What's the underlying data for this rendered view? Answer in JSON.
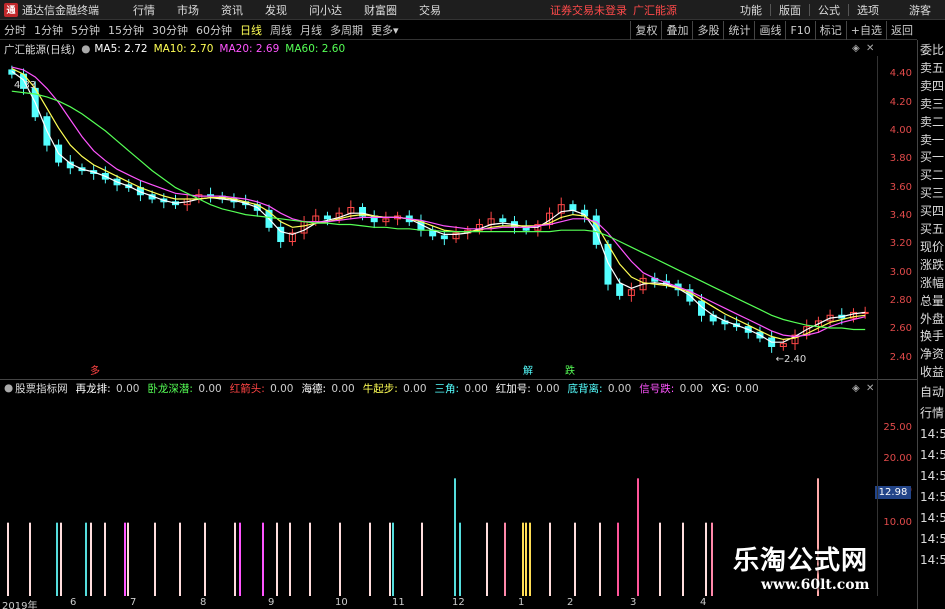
{
  "app": {
    "title": "通达信金融终端",
    "status": "证券交易未登录",
    "stock_short": "广汇能源",
    "menu": [
      "行情",
      "市场",
      "资讯",
      "发现",
      "问小达",
      "财富圈",
      "交易"
    ],
    "right_menu": [
      "功能",
      "版面",
      "公式",
      "选项"
    ],
    "guest": "游客"
  },
  "toolbar": {
    "items": [
      "分时",
      "1分钟",
      "5分钟",
      "15分钟",
      "30分钟",
      "60分钟",
      "日线",
      "周线",
      "月线",
      "多周期",
      "更多"
    ],
    "active": "日线",
    "right": [
      "复权",
      "叠加",
      "多股",
      "统计",
      "画线",
      "F10",
      "标记",
      "+自选",
      "返回"
    ]
  },
  "legend": {
    "stock": "广汇能源(日线)",
    "ma": [
      {
        "label": "MA5: 2.72",
        "color": "#ffffff"
      },
      {
        "label": "MA10: 2.70",
        "color": "#ffff55"
      },
      {
        "label": "MA20: 2.69",
        "color": "#ff55ff"
      },
      {
        "label": "MA60: 2.60",
        "color": "#55ff55"
      }
    ]
  },
  "price_axis": [
    "4.40",
    "4.20",
    "4.00",
    "3.80",
    "3.60",
    "3.40",
    "3.20",
    "3.00",
    "2.80",
    "2.60",
    "2.40"
  ],
  "annotations": {
    "high": "4.33",
    "low": "2.40",
    "signal_red": "多",
    "signal_a": "解",
    "signal_b": "跌"
  },
  "right_panel": [
    "委比",
    "卖五",
    "卖四",
    "卖三",
    "卖二",
    "卖一",
    "买一",
    "买二",
    "买三",
    "买四",
    "买五",
    "现价",
    "涨跌",
    "涨幅",
    "总量",
    "外盘",
    "换手",
    "净资",
    "收益"
  ],
  "right_panel_lower": [
    "自动",
    "行情",
    "14:5",
    "14:5",
    "14:5",
    "14:5",
    "14:5",
    "14:5",
    "14:5"
  ],
  "indicator": {
    "name": "股票指标网",
    "items": [
      {
        "label": "再龙排:",
        "value": "0.00",
        "color": "#ffffff"
      },
      {
        "label": "卧龙深潜:",
        "value": "0.00",
        "color": "#55ff55"
      },
      {
        "label": "红箭头:",
        "value": "0.00",
        "color": "#ff4444"
      },
      {
        "label": "海德:",
        "value": "0.00",
        "color": "#ffffff"
      },
      {
        "label": "牛起步:",
        "value": "0.00",
        "color": "#ffff55"
      },
      {
        "label": "三角:",
        "value": "0.00",
        "color": "#55ffff"
      },
      {
        "label": "红加号:",
        "value": "0.00",
        "color": "#ffffff"
      },
      {
        "label": "底背离:",
        "value": "0.00",
        "color": "#55ffff"
      },
      {
        "label": "信号跌:",
        "value": "0.00",
        "color": "#ff55ff"
      },
      {
        "label": "XG:",
        "value": "0.00",
        "color": "#ffffff"
      }
    ],
    "axis": [
      "25.00",
      "20.00",
      "15.00",
      "10.00"
    ],
    "highlight": "12.98"
  },
  "x_axis": [
    "2019年",
    "6",
    "7",
    "8",
    "9",
    "10",
    "11",
    "12",
    "1",
    "2",
    "3",
    "4"
  ],
  "watermark": {
    "main": "乐淘公式网",
    "sub": "www.60lt.com"
  },
  "chart_data": {
    "type": "candlestick",
    "title": "广汇能源(日线)",
    "ylim": [
      2.3,
      4.5
    ],
    "series": [
      {
        "name": "close",
        "values": [
          4.4,
          4.3,
          4.1,
          3.9,
          3.78,
          3.74,
          3.72,
          3.7,
          3.66,
          3.62,
          3.6,
          3.55,
          3.52,
          3.5,
          3.48,
          3.52,
          3.55,
          3.54,
          3.52,
          3.5,
          3.48,
          3.44,
          3.32,
          3.22,
          3.28,
          3.36,
          3.4,
          3.38,
          3.42,
          3.46,
          3.4,
          3.36,
          3.38,
          3.4,
          3.36,
          3.3,
          3.26,
          3.24,
          3.28,
          3.3,
          3.34,
          3.38,
          3.36,
          3.32,
          3.3,
          3.34,
          3.42,
          3.48,
          3.44,
          3.4,
          3.2,
          2.92,
          2.84,
          2.88,
          2.96,
          2.94,
          2.92,
          2.88,
          2.8,
          2.7,
          2.66,
          2.64,
          2.62,
          2.58,
          2.54,
          2.48,
          2.5,
          2.56,
          2.62,
          2.66,
          2.7,
          2.68,
          2.72,
          2.72
        ]
      },
      {
        "name": "MA5",
        "values": [
          4.42,
          4.36,
          4.2,
          4.0,
          3.84,
          3.77,
          3.73,
          3.71,
          3.68,
          3.64,
          3.61,
          3.57,
          3.54,
          3.51,
          3.49,
          3.5,
          3.52,
          3.53,
          3.52,
          3.51,
          3.49,
          3.46,
          3.38,
          3.29,
          3.27,
          3.3,
          3.35,
          3.37,
          3.39,
          3.42,
          3.42,
          3.4,
          3.39,
          3.39,
          3.38,
          3.34,
          3.3,
          3.27,
          3.27,
          3.28,
          3.31,
          3.34,
          3.35,
          3.34,
          3.32,
          3.32,
          3.37,
          3.43,
          3.44,
          3.41,
          3.29,
          3.07,
          2.93,
          2.89,
          2.92,
          2.93,
          2.92,
          2.89,
          2.84,
          2.76,
          2.7,
          2.66,
          2.63,
          2.6,
          2.56,
          2.51,
          2.51,
          2.55,
          2.6,
          2.64,
          2.68,
          2.69,
          2.71,
          2.72
        ]
      },
      {
        "name": "MA10",
        "values": [
          4.44,
          4.4,
          4.3,
          4.16,
          4.02,
          3.9,
          3.82,
          3.76,
          3.72,
          3.68,
          3.64,
          3.6,
          3.57,
          3.54,
          3.52,
          3.52,
          3.52,
          3.53,
          3.53,
          3.52,
          3.5,
          3.48,
          3.43,
          3.36,
          3.32,
          3.33,
          3.35,
          3.36,
          3.38,
          3.4,
          3.41,
          3.4,
          3.39,
          3.39,
          3.38,
          3.36,
          3.33,
          3.3,
          3.29,
          3.29,
          3.3,
          3.32,
          3.33,
          3.33,
          3.33,
          3.33,
          3.35,
          3.39,
          3.41,
          3.4,
          3.34,
          3.2,
          3.06,
          2.97,
          2.93,
          2.92,
          2.91,
          2.89,
          2.86,
          2.81,
          2.76,
          2.71,
          2.67,
          2.63,
          2.59,
          2.55,
          2.53,
          2.54,
          2.57,
          2.61,
          2.65,
          2.67,
          2.69,
          2.7
        ]
      },
      {
        "name": "MA20",
        "values": [
          4.45,
          4.43,
          4.38,
          4.3,
          4.2,
          4.08,
          3.96,
          3.86,
          3.79,
          3.73,
          3.69,
          3.65,
          3.62,
          3.59,
          3.56,
          3.55,
          3.54,
          3.54,
          3.54,
          3.53,
          3.52,
          3.5,
          3.47,
          3.42,
          3.38,
          3.36,
          3.36,
          3.36,
          3.37,
          3.38,
          3.39,
          3.39,
          3.39,
          3.39,
          3.38,
          3.37,
          3.35,
          3.33,
          3.32,
          3.31,
          3.31,
          3.31,
          3.32,
          3.32,
          3.32,
          3.33,
          3.34,
          3.36,
          3.38,
          3.38,
          3.36,
          3.28,
          3.18,
          3.08,
          3.0,
          2.96,
          2.93,
          2.9,
          2.87,
          2.83,
          2.79,
          2.75,
          2.71,
          2.67,
          2.63,
          2.59,
          2.56,
          2.55,
          2.56,
          2.58,
          2.62,
          2.65,
          2.67,
          2.69
        ]
      },
      {
        "name": "MA60",
        "values": [
          4.28,
          4.27,
          4.26,
          4.24,
          4.21,
          4.17,
          4.12,
          4.06,
          4.0,
          3.93,
          3.86,
          3.79,
          3.72,
          3.66,
          3.6,
          3.56,
          3.52,
          3.48,
          3.45,
          3.43,
          3.41,
          3.4,
          3.39,
          3.38,
          3.37,
          3.36,
          3.35,
          3.35,
          3.34,
          3.34,
          3.33,
          3.32,
          3.32,
          3.31,
          3.31,
          3.3,
          3.3,
          3.29,
          3.29,
          3.29,
          3.29,
          3.29,
          3.29,
          3.29,
          3.29,
          3.29,
          3.29,
          3.3,
          3.3,
          3.3,
          3.29,
          3.26,
          3.22,
          3.18,
          3.14,
          3.1,
          3.06,
          3.02,
          2.98,
          2.94,
          2.9,
          2.86,
          2.82,
          2.78,
          2.74,
          2.7,
          2.67,
          2.65,
          2.63,
          2.62,
          2.61,
          2.61,
          2.6,
          2.6
        ]
      }
    ]
  }
}
